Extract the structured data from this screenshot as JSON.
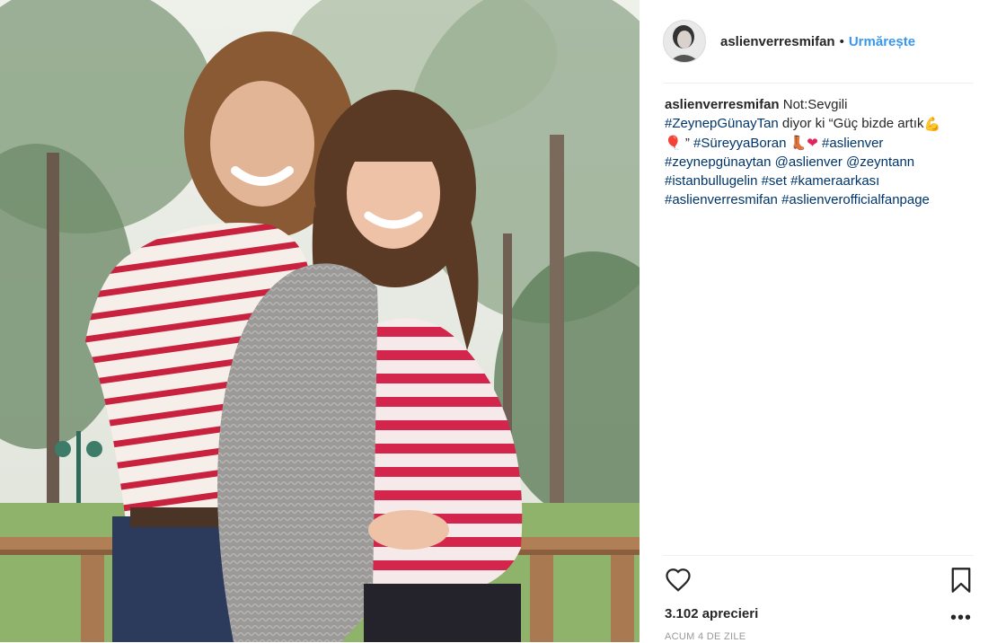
{
  "post": {
    "username": "aslienverresmifan",
    "dot": "•",
    "follow_label": "Urmărește"
  },
  "caption": {
    "username": "aslienverresmifan",
    "text_1": " Not:Sevgili ",
    "tag_zeynep": "#ZeynepGünayTan",
    "text_2": " diyor ki “Güç bizde artık",
    "emoji_muscle": "💪",
    "emoji_balloon": "🎈",
    "text_3": " ” ",
    "tag_sureyya": "#SüreyyaBoran",
    "emoji_shoe": "👢",
    "emoji_heart": "❤",
    "tag_aslienver": "#aslienver",
    "tag_zeynepg": "#zeynepgünaytan",
    "mention_aslienver": "@aslienver",
    "mention_zeyntann": "@zeyntann",
    "tag_istanbul": "#istanbullugelin",
    "tag_set": "#set",
    "tag_kamera": "#kameraarkası",
    "tag_resmifan": "#aslienverresmifan",
    "tag_fanpage": "#aslienverofficialfanpage"
  },
  "actions": {
    "heart_icon": "heart-outline",
    "bookmark_icon": "bookmark-outline",
    "likes": "3.102 aprecieri",
    "more": "•••",
    "time": "ACUM 4 DE ZILE"
  },
  "colors": {
    "link": "#003569",
    "follow": "#3897f0",
    "stripe_red": "#c8223f"
  }
}
